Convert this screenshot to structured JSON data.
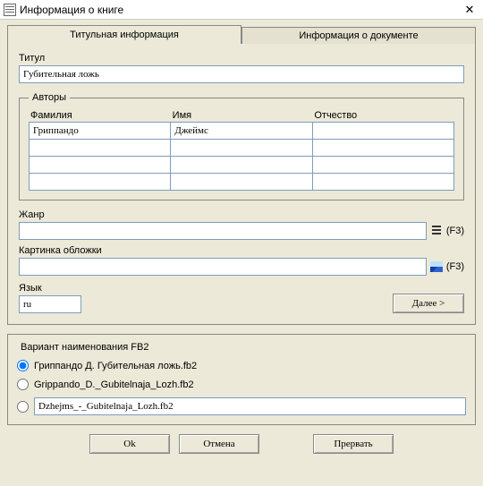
{
  "window": {
    "title": "Информация о книге",
    "close": "✕"
  },
  "tabs": {
    "title_info": "Титульная информация",
    "doc_info": "Информация о документе"
  },
  "fields": {
    "title_label": "Титул",
    "title_value": "Губительная ложь",
    "authors_label": "Авторы",
    "surname_label": "Фамилия",
    "name_label": "Имя",
    "patronymic_label": "Отчество",
    "genre_label": "Жанр",
    "genre_value": "",
    "cover_label": "Картинка обложки",
    "cover_value": "",
    "lang_label": "Язык",
    "lang_value": "ru",
    "f3_hint": "(F3)",
    "next_btn": "Далее >"
  },
  "authors": [
    {
      "surname": "Гриппандо",
      "name": "Джеймс",
      "patronymic": ""
    },
    {
      "surname": "",
      "name": "",
      "patronymic": ""
    },
    {
      "surname": "",
      "name": "",
      "patronymic": ""
    },
    {
      "surname": "",
      "name": "",
      "patronymic": ""
    }
  ],
  "fb2": {
    "group_label": "Вариант наименования FB2",
    "opt1": "Гриппандо Д.  Губительная ложь.fb2",
    "opt2": "Grippando_D._Gubitelnaja_Lozh.fb2",
    "opt3": "Dzhejms_-_Gubitelnaja_Lozh.fb2",
    "selected": 0
  },
  "buttons": {
    "ok": "Ok",
    "cancel": "Отмена",
    "abort": "Прервать"
  }
}
